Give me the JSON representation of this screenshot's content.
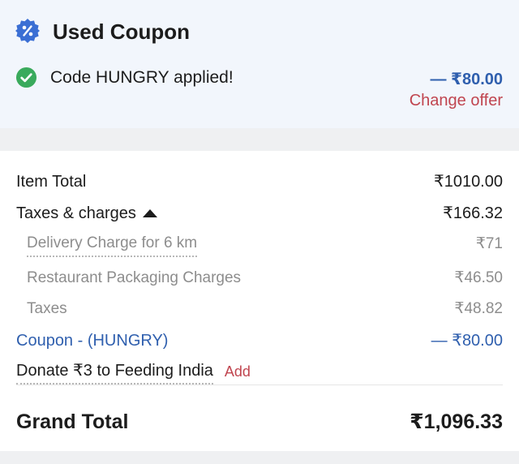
{
  "coupon": {
    "title": "Used Coupon",
    "applied_text": "Code HUNGRY applied!",
    "discount": "— ₹80.00",
    "change_offer_label": "Change offer",
    "badge_icon": "percent-badge-icon",
    "check_icon": "check-circle-icon",
    "accent_color": "#2f5fae",
    "check_color": "#3aaa5c",
    "link_color": "#c0454f"
  },
  "bill": {
    "item_total": {
      "label": "Item Total",
      "value": "₹1010.00"
    },
    "taxes_charges": {
      "label": "Taxes & charges",
      "value": "₹166.32"
    },
    "breakdown": [
      {
        "label": "Delivery Charge for 6 km",
        "value": "₹71"
      },
      {
        "label": "Restaurant Packaging Charges",
        "value": "₹46.50"
      },
      {
        "label": "Taxes",
        "value": "₹48.82"
      }
    ],
    "coupon_line": {
      "label": "Coupon - (HUNGRY)",
      "value": "— ₹80.00"
    },
    "donate": {
      "label": "Donate ₹3 to Feeding India",
      "action": "Add"
    },
    "grand_total": {
      "label": "Grand Total",
      "value": "₹1,096.33"
    }
  }
}
